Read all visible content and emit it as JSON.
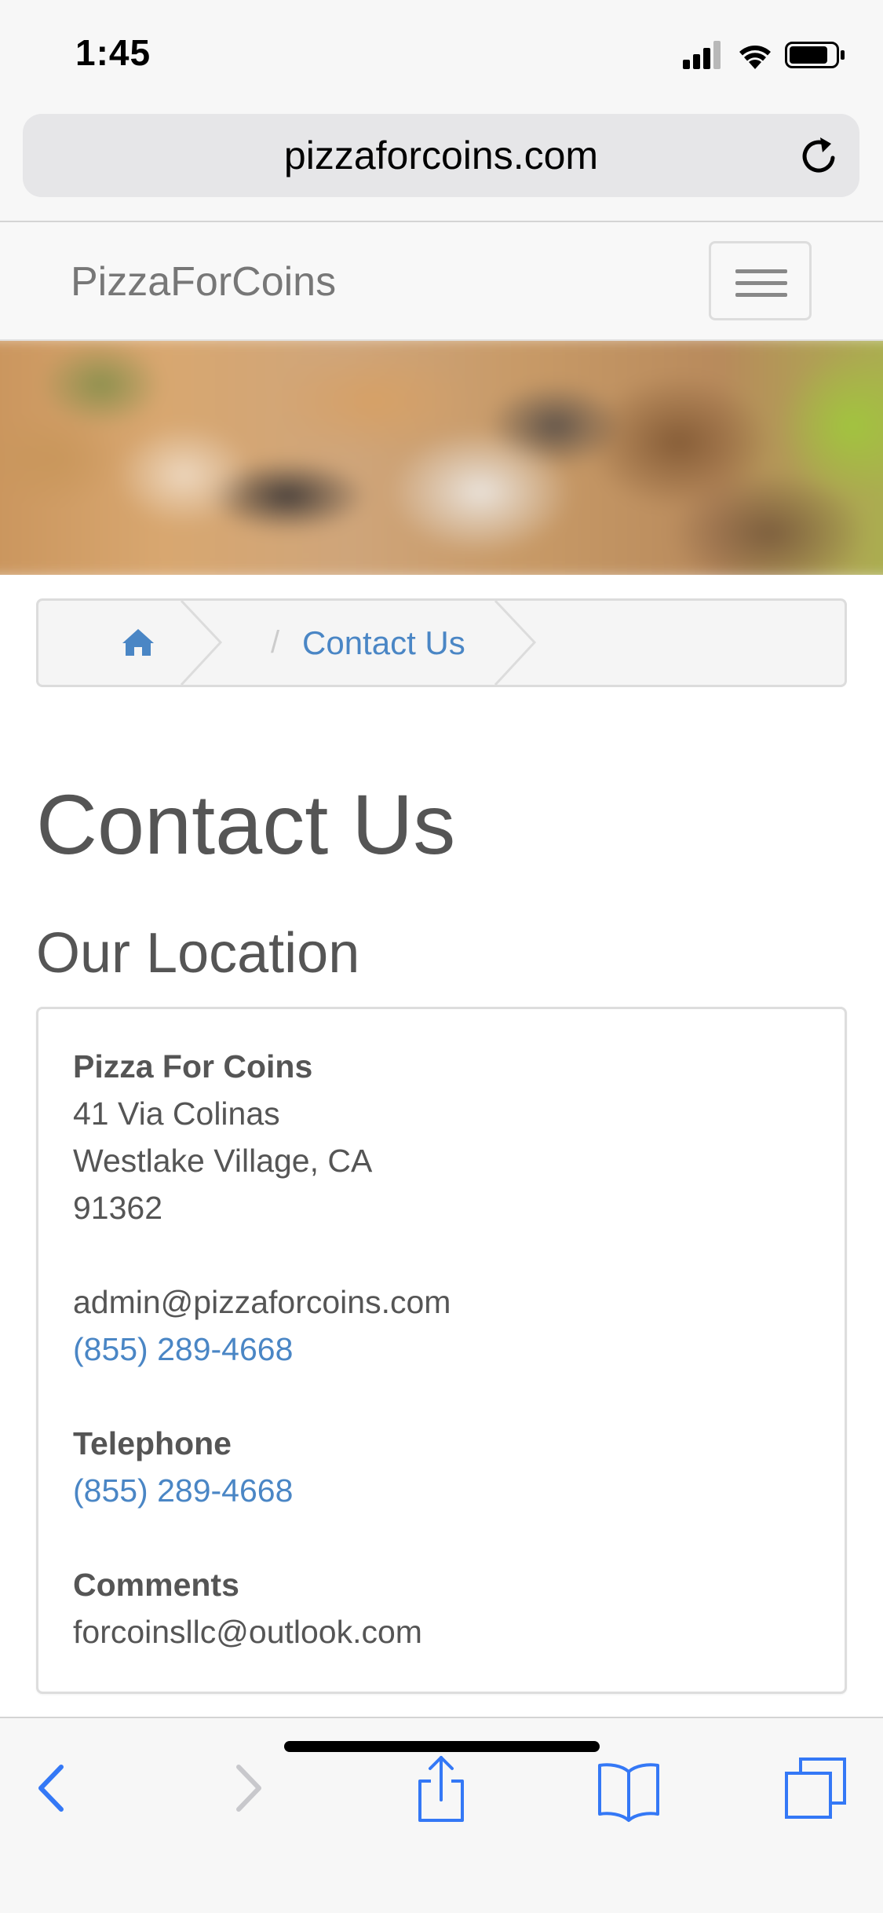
{
  "status_bar": {
    "time": "1:45"
  },
  "browser": {
    "url": "pizzaforcoins.com"
  },
  "navbar": {
    "brand": "PizzaForCoins"
  },
  "breadcrumb": {
    "separator": "/",
    "current": "Contact Us"
  },
  "page": {
    "title": "Contact Us",
    "section_title": "Our Location"
  },
  "location": {
    "name": "Pizza For Coins",
    "street": "41 Via Colinas",
    "city_state": "Westlake Village, CA",
    "zip": "91362",
    "email": "admin@pizzaforcoins.com",
    "phone": "(855) 289-4668",
    "telephone_label": "Telephone",
    "telephone": "(855) 289-4668",
    "comments_label": "Comments",
    "comments_email": "forcoinsllc@outlook.com"
  },
  "colors": {
    "link": "#4a86c5",
    "text": "#555555",
    "safari_blue": "#3478f6"
  },
  "icons": {
    "signal": "cellular-signal-icon",
    "wifi": "wifi-icon",
    "battery": "battery-icon",
    "reload": "reload-icon",
    "home": "home-icon",
    "menu": "hamburger-menu-icon",
    "back": "chevron-left-icon",
    "forward": "chevron-right-icon",
    "share": "share-icon",
    "bookmarks": "book-icon",
    "tabs": "tabs-icon"
  }
}
